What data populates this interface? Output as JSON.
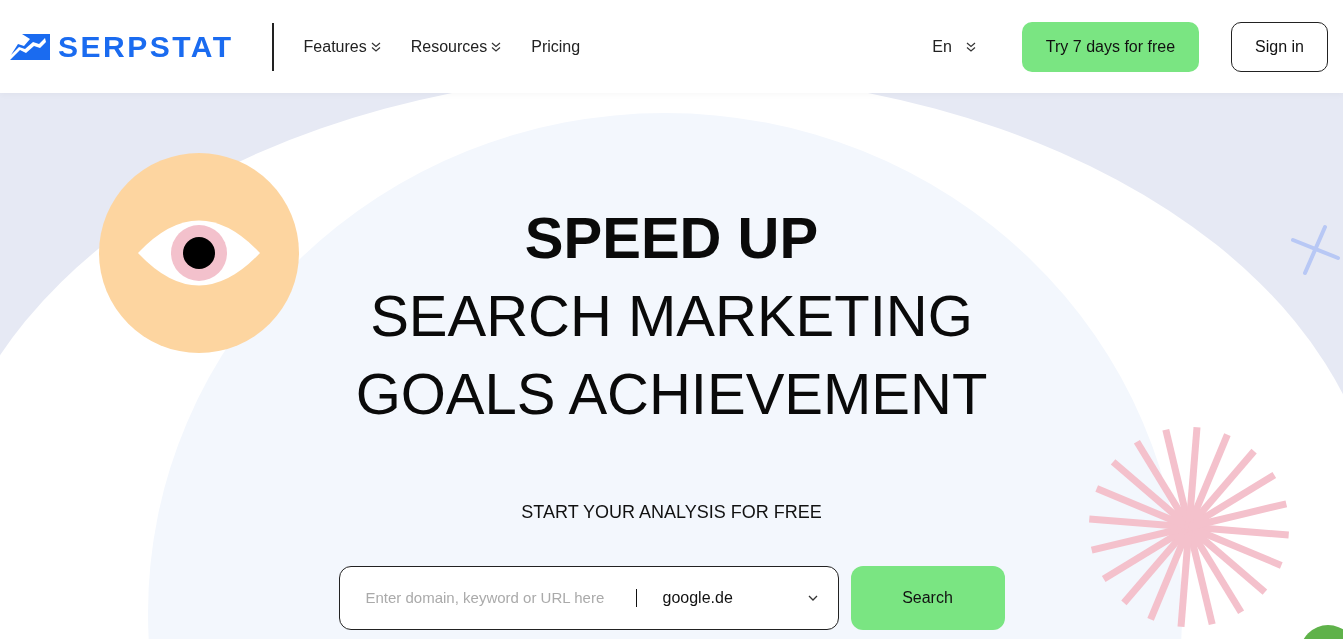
{
  "logo": {
    "text": "SERPSTAT"
  },
  "nav": [
    {
      "label": "Features",
      "dropdown": true
    },
    {
      "label": "Resources",
      "dropdown": true
    },
    {
      "label": "Pricing",
      "dropdown": false
    }
  ],
  "language": {
    "label": "En"
  },
  "trial_button": "Try 7 days for free",
  "sign_in_button": "Sign in",
  "hero": {
    "title_lines": [
      {
        "text": "SPEED UP",
        "bold": true
      },
      {
        "text": "SEARCH MARKETING",
        "bold": false
      },
      {
        "text": "GOALS ACHIEVEMENT",
        "bold": false
      }
    ],
    "subtitle": "START YOUR ANALYSIS FOR FREE"
  },
  "search": {
    "placeholder": "Enter domain, keyword or URL here",
    "engine": "google.de",
    "button": "Search"
  }
}
